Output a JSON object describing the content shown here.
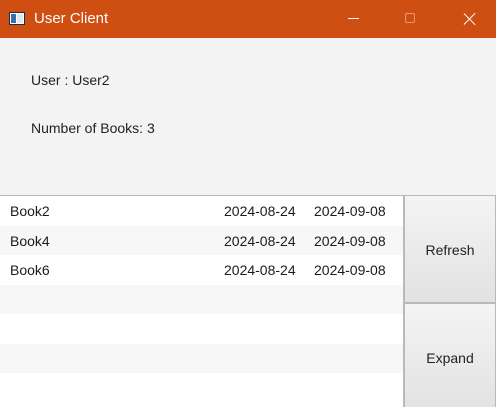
{
  "window": {
    "title": "User Client",
    "colors": {
      "titlebar": "#cf4f12",
      "background": "#f3f3f3",
      "list_background": "#ffffff"
    }
  },
  "info": {
    "user_label": "User : User2",
    "books_label": "Number of Books: 3"
  },
  "books": [
    {
      "title": "Book2",
      "start": "2024-08-24",
      "end": "2024-09-08"
    },
    {
      "title": "Book4",
      "start": "2024-08-24",
      "end": "2024-09-08"
    },
    {
      "title": "Book6",
      "start": "2024-08-24",
      "end": "2024-09-08"
    }
  ],
  "empty_rows": 4,
  "buttons": {
    "refresh": "Refresh",
    "expand": "Expand"
  },
  "icons": {
    "app": "app-window-icon",
    "minimize": "minimize-icon",
    "maximize": "maximize-icon",
    "close": "close-icon"
  }
}
